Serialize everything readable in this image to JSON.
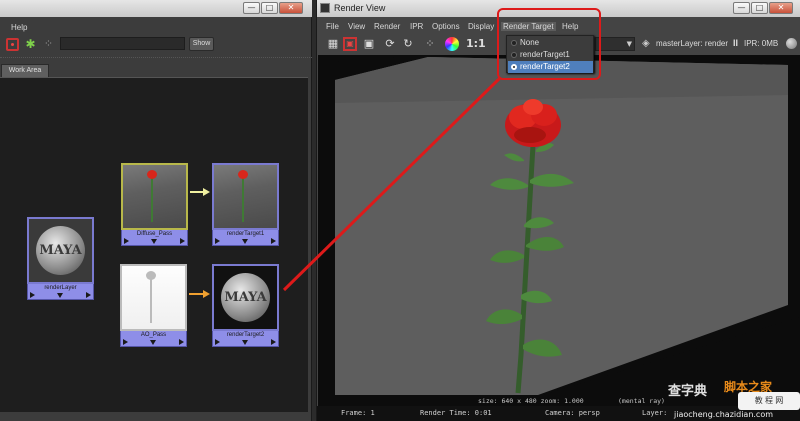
{
  "left_window": {
    "menu": {
      "help": "Help"
    },
    "toolbar": {
      "search_value": "",
      "show_button": "Show"
    },
    "tab": "Work Area",
    "window_buttons": {
      "minimize": "—",
      "maximize": "□",
      "close": "✕"
    },
    "nodes": [
      {
        "id": "renderLayer",
        "label": "renderLayer",
        "thumb": "maya-logo"
      },
      {
        "id": "diffuse",
        "label": "Diffuse_Pass",
        "thumb": "rose"
      },
      {
        "id": "rt1",
        "label": "renderTarget1",
        "thumb": "rose"
      },
      {
        "id": "ao",
        "label": "AO_Pass",
        "thumb": "ao-rose"
      },
      {
        "id": "rt2",
        "label": "renderTarget2",
        "thumb": "maya-logo"
      }
    ],
    "logo_text": "MAYA",
    "connection_colors": {
      "diffuse": "#f0f0a0",
      "ao": "#f0a030"
    }
  },
  "render_view": {
    "title": "Render View",
    "window_buttons": {
      "minimize": "—",
      "maximize": "□",
      "close": "✕"
    },
    "menus": [
      "File",
      "View",
      "Render",
      "IPR",
      "Options",
      "Display",
      "Render Target",
      "Help"
    ],
    "toolbar": {
      "ratio": "1:1",
      "layer_text": "masterLayer: render",
      "pause": "II",
      "ipr_text": "IPR: 0MB"
    },
    "render_target_menu": [
      {
        "label": "None",
        "selected": false
      },
      {
        "label": "renderTarget1",
        "selected": false
      },
      {
        "label": "renderTarget2",
        "selected": true
      }
    ],
    "image_info": "size: 640 x 480  zoom: 1.000",
    "image_info2": "(mental ray)",
    "status": {
      "frame": "Frame: 1",
      "render_time": "Render Time: 0:01",
      "camera": "Camera: persp",
      "layer": "Layer:"
    }
  },
  "colors": {
    "highlight": "#dd1a1a",
    "menu_selection": "#4f7fbd",
    "node_label": "#8e8ee8",
    "rose": "#d8261b",
    "stem": "#3f7a34"
  },
  "watermark": {
    "cn1": "查字典",
    "cn2": "脚本之家",
    "stamp": "教 程 网",
    "url": "jiaocheng.chazidian.com"
  }
}
